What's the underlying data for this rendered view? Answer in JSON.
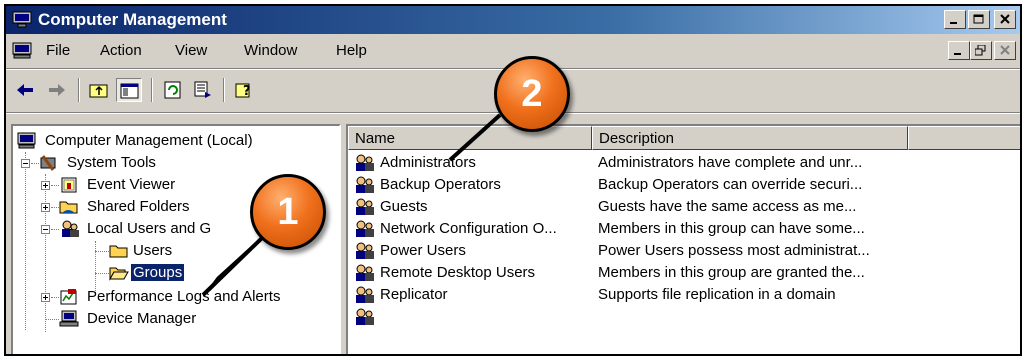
{
  "window": {
    "title": "Computer Management"
  },
  "menu": {
    "items": [
      "File",
      "Action",
      "View",
      "Window",
      "Help"
    ]
  },
  "tree": {
    "items": [
      {
        "label": "Computer Management (Local)"
      },
      {
        "label": "System Tools"
      },
      {
        "label": "Event Viewer"
      },
      {
        "label": "Shared Folders"
      },
      {
        "label": "Local Users and G"
      },
      {
        "label": "Users"
      },
      {
        "label": "Groups"
      },
      {
        "label": "Performance Logs and Alerts"
      },
      {
        "label": "Device Manager"
      }
    ]
  },
  "list": {
    "columns": [
      "Name",
      "Description"
    ],
    "rows": [
      {
        "name": "Administrators",
        "description": "Administrators have complete and unr..."
      },
      {
        "name": "Backup Operators",
        "description": "Backup Operators can override securi..."
      },
      {
        "name": "Guests",
        "description": "Guests have the same access as me..."
      },
      {
        "name": "Network Configuration O...",
        "description": "Members in this group can have some..."
      },
      {
        "name": "Power Users",
        "description": "Power Users possess most administrat..."
      },
      {
        "name": "Remote Desktop Users",
        "description": "Members in this group are granted the..."
      },
      {
        "name": "Replicator",
        "description": "Supports file replication in a domain"
      }
    ]
  },
  "callouts": [
    "1",
    "2"
  ],
  "colors": {
    "titlebar_start": "#0a246a",
    "titlebar_end": "#a6caf0",
    "selection": "#0a246a",
    "callout": "#f0701c"
  }
}
